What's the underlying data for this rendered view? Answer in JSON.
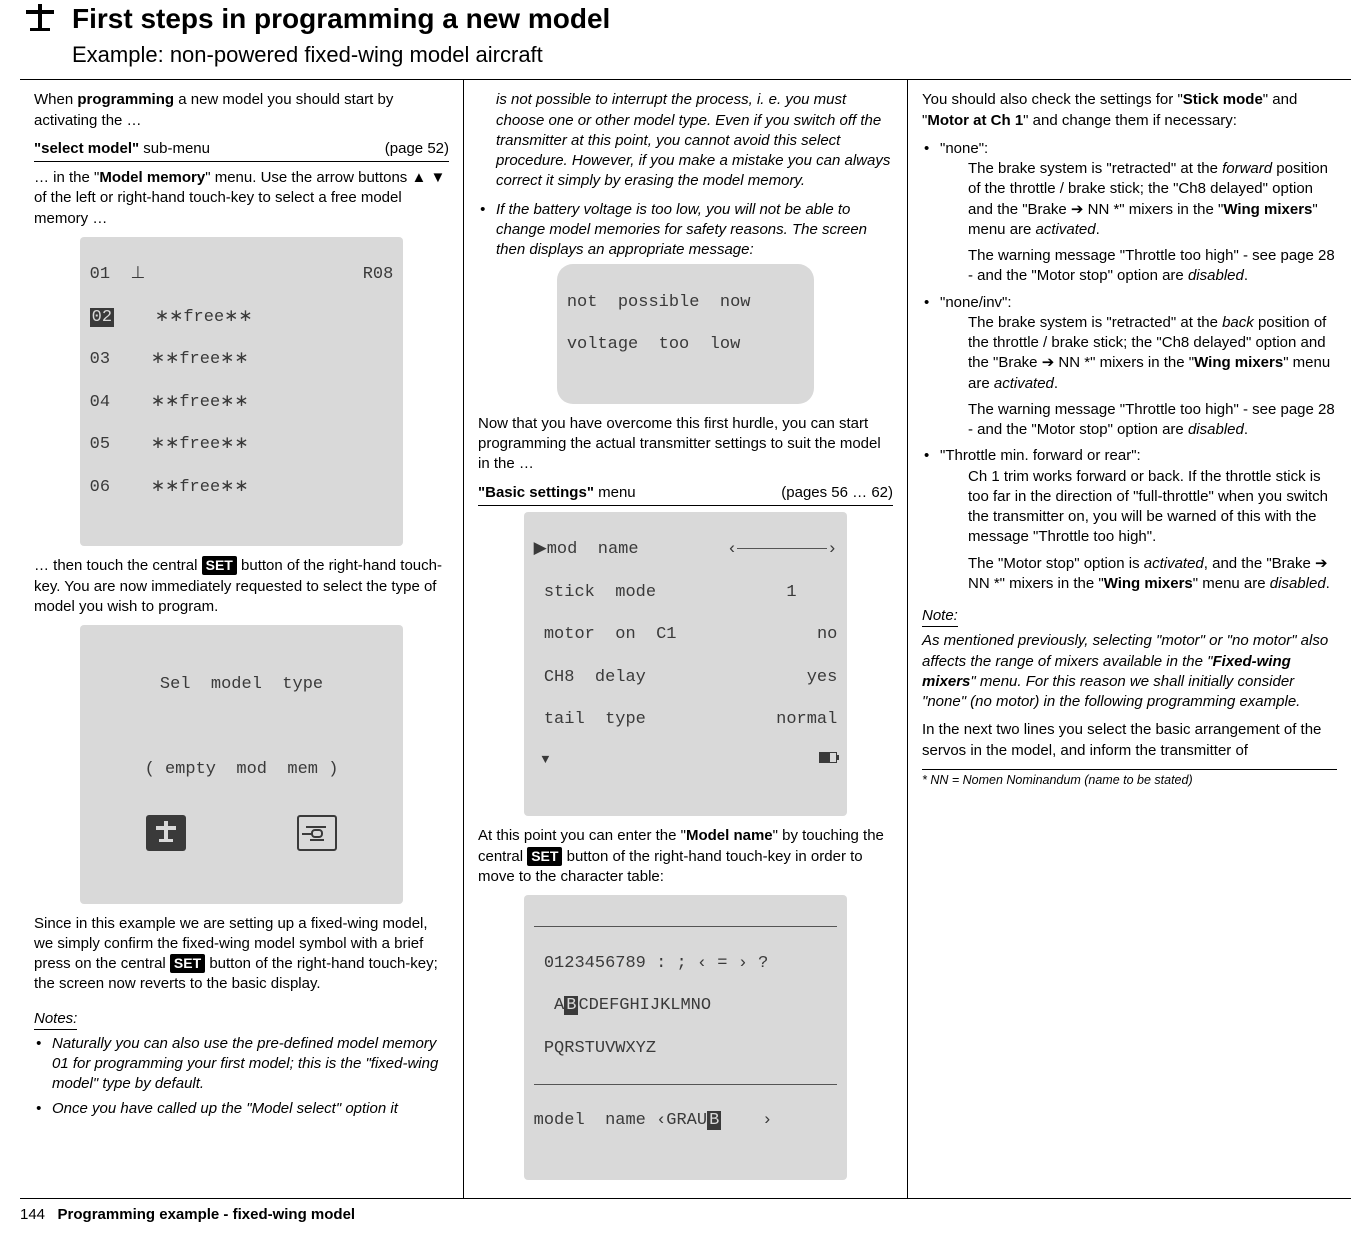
{
  "header": {
    "title": "First steps in programming a new model",
    "subtitle": "Example: non-powered fixed-wing model aircraft"
  },
  "col1": {
    "p1a": "When ",
    "p1b": "programming",
    "p1c": " a new model you should start by activating the …",
    "subhead1_label_a": "\"select model\"",
    "subhead1_label_b": " sub-menu",
    "subhead1_page": "(page 52)",
    "p2a": "… in the \"",
    "p2b": "Model memory",
    "p2c": "\" menu. Use the arrow buttons ▲ ▼ of the left or right-hand touch-key to select a free model memory …",
    "lcd1_row1_left": "01  ",
    "lcd1_row1_right": "R08",
    "lcd1_row2_num": "02",
    "lcd1_free": "    ∗∗free∗∗",
    "lcd1_r3": "03",
    "lcd1_r4": "04",
    "lcd1_r5": "05",
    "lcd1_r6": "06",
    "p3a": "… then touch the central ",
    "set": "SET",
    "p3b": " button of the right-hand touch-key. You are now immediately requested to select the type of model you wish to program.",
    "lcd2_l1": "Sel  model  type",
    "lcd2_l2": "( empty  mod  mem )",
    "p4a": "Since in this example we are setting up a fixed-wing model, we simply confirm the fixed-wing model symbol with a brief press on the central ",
    "p4b": " button of the right-hand touch-key; the screen now reverts to the basic display.",
    "notes_head": "Notes:",
    "note1": "Naturally you can also use the pre-defined model memory 01 for programming your first model; this is the \"fixed-wing model\" type by default.",
    "note2": "Once you have called up the \"Model select\" option it"
  },
  "col2": {
    "p1": "is not possible to interrupt the process, i. e. you must choose one or other model type. Even if you switch off the transmitter at this point, you cannot avoid this select procedure. However, if you make a mistake you can always correct it simply by erasing the model memory.",
    "note2": "If the battery voltage is too low, you will not be able to change model memories for safety reasons. The screen then displays an appropriate message:",
    "lcd_msg_l1": "not  possible  now",
    "lcd_msg_l2": "voltage  too  low",
    "p2": "Now that you have overcome this first hurdle, you can start programming the actual transmitter settings to suit the model in the …",
    "subhead_label_a": "\"Basic settings\"",
    "subhead_label_b": " menu",
    "subhead_page": "(pages 56 … 62)",
    "lcd_bs_r1_l": "▶mod  name",
    "lcd_bs_r2_l": " stick  mode",
    "lcd_bs_r2_r": "1    ",
    "lcd_bs_r3_l": " motor  on  C1",
    "lcd_bs_r3_r": "no",
    "lcd_bs_r4_l": " CH8  delay",
    "lcd_bs_r4_r": "yes",
    "lcd_bs_r5_l": " tail  type",
    "lcd_bs_r5_r": "normal",
    "p3a": "At this point you can enter the \"",
    "p3b": "Model name",
    "p3c": "\" by touching the central ",
    "p3d": " button of the right-hand touch-key in order to move to the character table:",
    "lcd_ct_r1": " 0123456789 : ; ‹ = › ?",
    "lcd_ct_r2a": "  A",
    "lcd_ct_r2b": "B",
    "lcd_ct_r2c": "CDEFGHIJKLMNO",
    "lcd_ct_r3": " PQRSTUVWXYZ",
    "lcd_ct_r4a": "model  name ‹GRAU",
    "lcd_ct_r4b": "B",
    "lcd_ct_r4c": "    ›"
  },
  "col3": {
    "p1a": "You should also check the settings for \"",
    "p1b": "Stick mode",
    "p1c": "\" and \"",
    "p1d": "Motor at Ch 1",
    "p1e": "\" and change them if necessary:",
    "li1_head": "\"none\":",
    "li1_p1a": "The brake system is \"retracted\" at the ",
    "li1_p1b": "forward",
    "li1_p1c": " position of the throttle / brake stick; the \"Ch8 delayed\" option and the \"Brake ➔ NN *\" mixers in the \"",
    "li1_p1d": "Wing mixers",
    "li1_p1e": "\" menu are ",
    "li1_p1f": "activated",
    "li1_p1g": ".",
    "li1_p2a": "The warning message \"Throttle too high\" - see page 28 - and the \"Motor stop\" option are ",
    "li1_p2b": "disabled",
    "li1_p2c": ".",
    "li2_head": "\"none/inv\":",
    "li2_p1a": "The brake system is \"retracted\" at the ",
    "li2_p1b": "back",
    "li2_p1c": " position of the throttle / brake stick; the \"Ch8 delayed\" option and the \"Brake ➔ NN *\" mixers in the \"",
    "li2_p1d": "Wing mixers",
    "li2_p1e": "\" menu are ",
    "li2_p1f": "activated",
    "li2_p1g": ".",
    "li2_p2a": "The warning message \"Throttle too high\" - see page 28 - and the \"Motor stop\" option are ",
    "li2_p2b": "disabled",
    "li2_p2c": ".",
    "li3_head": "\"Throttle min. forward or rear\":",
    "li3_p1": "Ch 1 trim works forward or back. If the throttle stick is too far in the direction of \"full-throttle\" when you switch the transmitter on, you will be warned of this with the message \"Throttle too high\".",
    "li3_p2a": "The \"Motor stop\" option is ",
    "li3_p2b": "activated",
    "li3_p2c": ", and the \"Brake ➔ NN *\" mixers in the \"",
    "li3_p2d": "Wing mixers",
    "li3_p2e": "\" menu are ",
    "li3_p2f": "disabled",
    "li3_p2g": ".",
    "note_head": "Note:",
    "note_a": "As mentioned previously, selecting \"motor\" or \"no motor\" also affects the range of mixers available in the \"",
    "note_b": "Fixed-wing mixers",
    "note_c": "\" menu. For this reason we shall initially consider \"none\" (no motor) in the following programming example.",
    "p_last": "In the next two lines you select the basic arrangement of the servos in the model, and inform the transmitter of",
    "footnote": "*    NN = Nomen Nominandum (name to be stated)"
  },
  "footer": {
    "page_num": "144",
    "section": "Programming example - fixed-wing model"
  }
}
